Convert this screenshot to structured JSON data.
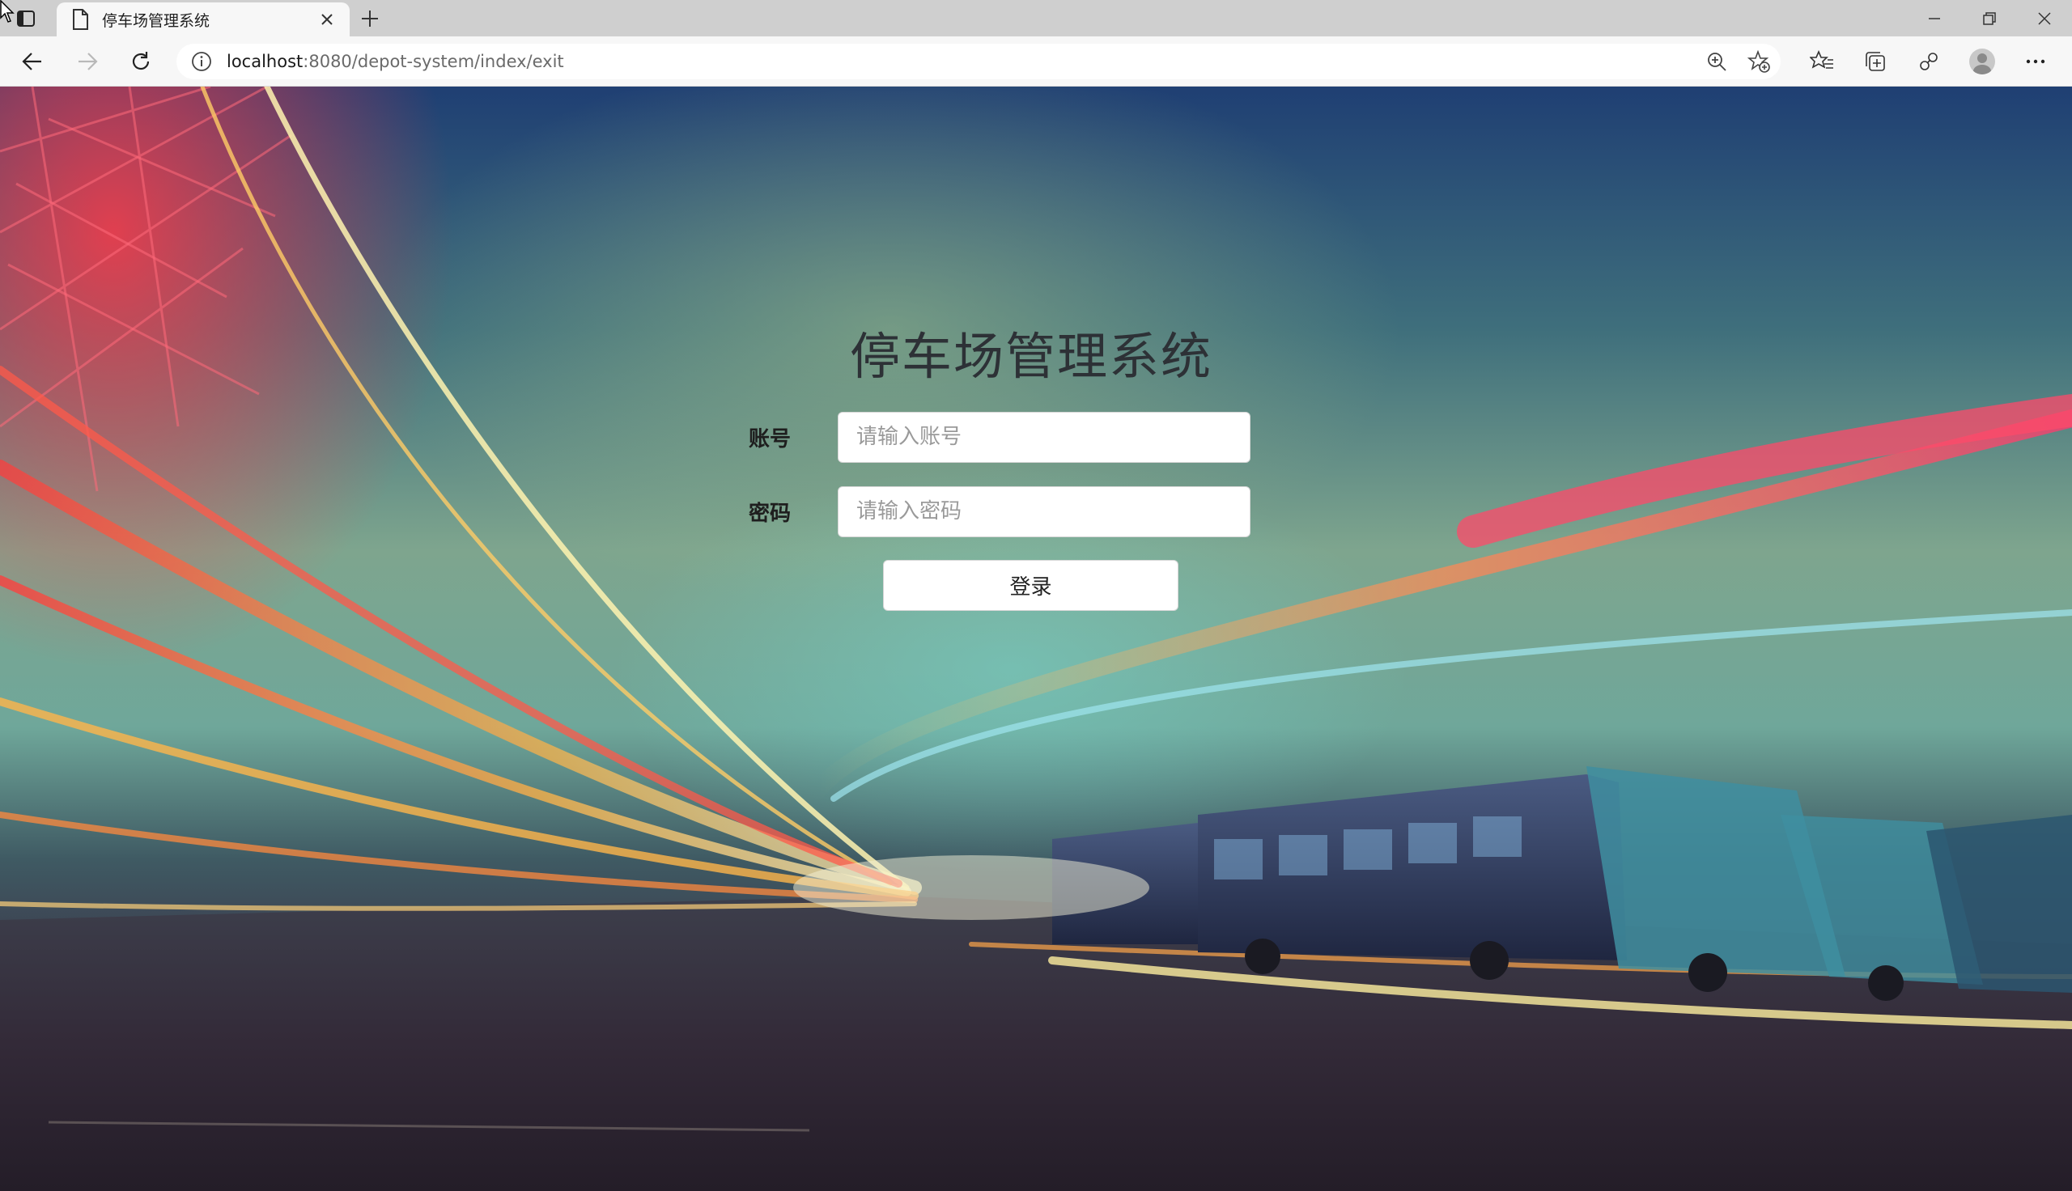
{
  "browser": {
    "tab": {
      "title": "停车场管理系统"
    },
    "address": {
      "host": "localhost",
      "rest": ":8080/depot-system/index/exit"
    }
  },
  "login": {
    "title": "停车场管理系统",
    "account_label": "账号",
    "account_placeholder": "请输入账号",
    "account_value": "",
    "password_label": "密码",
    "password_placeholder": "请输入密码",
    "password_value": "",
    "submit_label": "登录"
  },
  "colors": {
    "title_text": "#2d3136",
    "input_bg": "#ffffff",
    "tabstrip_bg": "#cfcfcf",
    "toolbar_bg": "#f7f7f7"
  }
}
